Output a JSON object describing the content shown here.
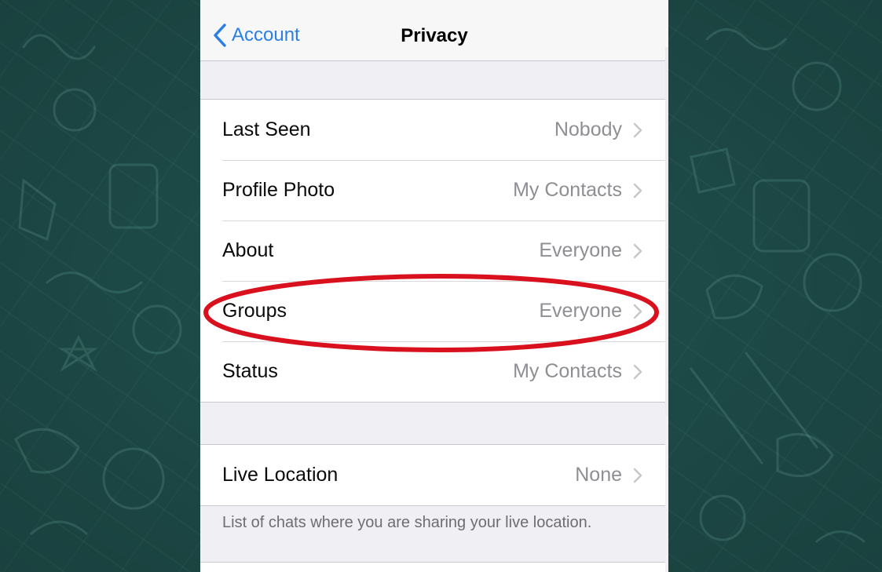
{
  "navbar": {
    "back_label": "Account",
    "title": "Privacy"
  },
  "privacy_rows": [
    {
      "label": "Last Seen",
      "value": "Nobody"
    },
    {
      "label": "Profile Photo",
      "value": "My Contacts"
    },
    {
      "label": "About",
      "value": "Everyone"
    },
    {
      "label": "Groups",
      "value": "Everyone"
    },
    {
      "label": "Status",
      "value": "My Contacts"
    }
  ],
  "location_rows": [
    {
      "label": "Live Location",
      "value": "None"
    }
  ],
  "live_location_note": "List of chats where you are sharing your live location.",
  "colors": {
    "accent": "#2a7fe6",
    "highlight": "#d9101d",
    "background": "#1f4f4c"
  },
  "icons": {
    "back": "chevron-left-icon",
    "row": "chevron-right-icon"
  }
}
